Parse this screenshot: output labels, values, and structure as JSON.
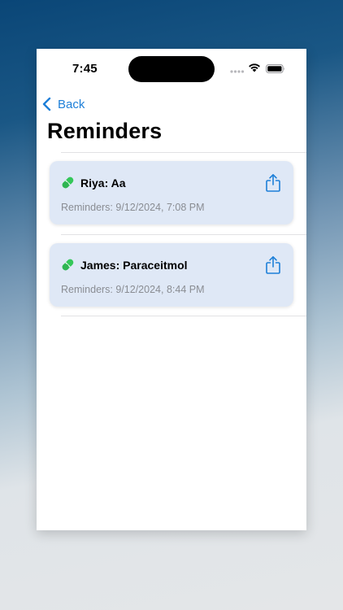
{
  "status_bar": {
    "time": "7:45"
  },
  "nav": {
    "back_label": "Back"
  },
  "page": {
    "title": "Reminders"
  },
  "reminders": [
    {
      "title": "Riya: Aa",
      "subtitle": "Reminders: 9/12/2024, 7:08 PM",
      "icon": "pill-icon"
    },
    {
      "title": "James: Paraceitmol",
      "subtitle": "Reminders: 9/12/2024, 8:44 PM",
      "icon": "pill-icon"
    }
  ],
  "colors": {
    "accent": "#1d7fd8",
    "card_background": "#dfe8f6",
    "pill_green": "#34c759",
    "subtitle_gray": "#8a8d93"
  }
}
